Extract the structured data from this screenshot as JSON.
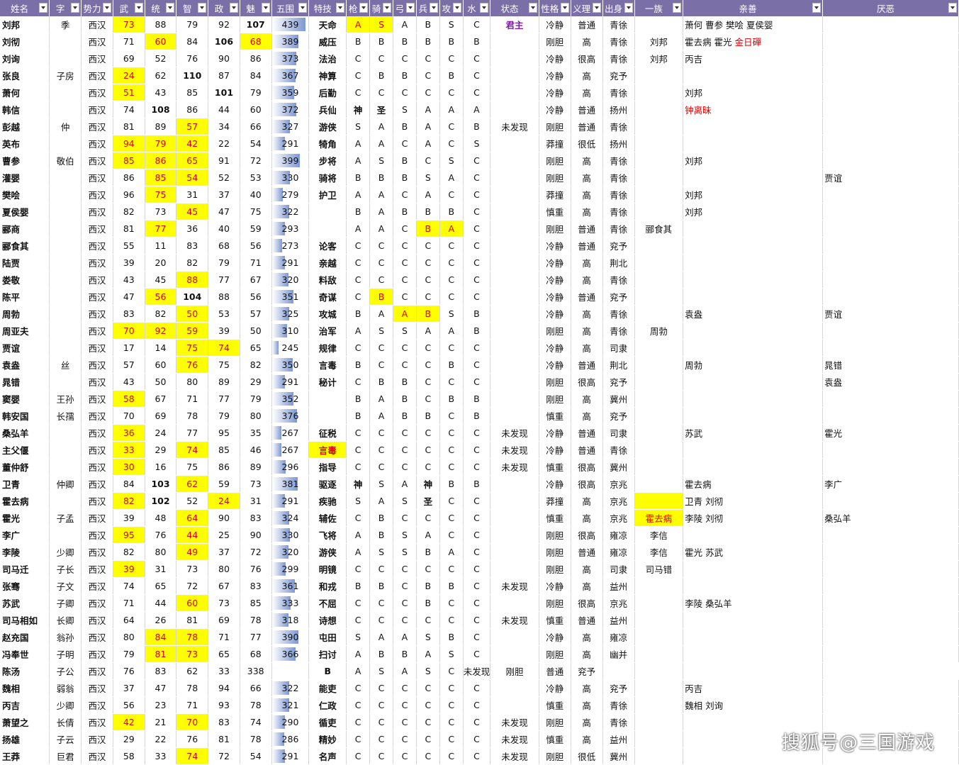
{
  "headers": [
    "姓名",
    "字",
    "势力",
    "武",
    "统",
    "智",
    "政",
    "魅",
    "五围",
    "特技",
    "枪",
    "骑",
    "弓",
    "兵",
    "攻",
    "水",
    "状态",
    "性格",
    "义理",
    "出身",
    "一族",
    "亲善",
    "厌恶"
  ],
  "rows": [
    [
      "刘邦",
      "季",
      "西汉",
      "73",
      "88",
      "79",
      "92",
      "107",
      "439",
      "天命",
      "A",
      "S",
      "A",
      "B",
      "S",
      "C",
      "君主",
      "冷静",
      "普通",
      "青徐",
      "",
      "萧何 曹参 樊哙 夏侯婴",
      ""
    ],
    [
      "刘彻",
      "",
      "西汉",
      "71",
      "60",
      "84",
      "106",
      "68",
      "389",
      "威压",
      "B",
      "B",
      "B",
      "B",
      "B",
      "B",
      "",
      "刚胆",
      "高",
      "青徐",
      "刘邦",
      "霍去病 霍光 金日磾",
      ""
    ],
    [
      "刘询",
      "",
      "西汉",
      "69",
      "52",
      "76",
      "90",
      "86",
      "373",
      "法治",
      "C",
      "C",
      "C",
      "C",
      "C",
      "C",
      "",
      "冷静",
      "很高",
      "青徐",
      "刘邦",
      "丙吉",
      ""
    ],
    [
      "张良",
      "子房",
      "西汉",
      "24",
      "62",
      "110",
      "87",
      "84",
      "367",
      "神算",
      "C",
      "B",
      "B",
      "C",
      "B",
      "C",
      "",
      "冷静",
      "高",
      "兖予",
      "",
      "",
      ""
    ],
    [
      "萧何",
      "",
      "西汉",
      "51",
      "43",
      "85",
      "101",
      "79",
      "359",
      "后勤",
      "C",
      "C",
      "C",
      "C",
      "C",
      "C",
      "",
      "冷静",
      "高",
      "青徐",
      "",
      "刘邦",
      ""
    ],
    [
      "韩信",
      "",
      "西汉",
      "74",
      "108",
      "86",
      "44",
      "60",
      "372",
      "兵仙",
      "神",
      "圣",
      "S",
      "A",
      "A",
      "A",
      "",
      "冷静",
      "普通",
      "扬州",
      "",
      "钟离昧",
      ""
    ],
    [
      "彭越",
      "仲",
      "西汉",
      "81",
      "89",
      "57",
      "34",
      "66",
      "327",
      "游侠",
      "S",
      "A",
      "B",
      "A",
      "C",
      "B",
      "未发现",
      "刚胆",
      "普通",
      "青徐",
      "",
      "",
      ""
    ],
    [
      "英布",
      "",
      "西汉",
      "94",
      "79",
      "42",
      "22",
      "54",
      "291",
      "犄角",
      "A",
      "A",
      "C",
      "A",
      "C",
      "S",
      "",
      "莽撞",
      "很低",
      "扬州",
      "",
      "",
      ""
    ],
    [
      "曹参",
      "敬伯",
      "西汉",
      "85",
      "86",
      "65",
      "91",
      "72",
      "399",
      "步将",
      "A",
      "S",
      "B",
      "C",
      "S",
      "C",
      "",
      "刚胆",
      "高",
      "青徐",
      "",
      "刘邦",
      ""
    ],
    [
      "灌婴",
      "",
      "西汉",
      "86",
      "85",
      "54",
      "52",
      "53",
      "330",
      "骑将",
      "B",
      "B",
      "B",
      "S",
      "A",
      "C",
      "",
      "刚胆",
      "高",
      "青徐",
      "",
      "",
      "贾谊"
    ],
    [
      "樊哙",
      "",
      "西汉",
      "96",
      "75",
      "31",
      "37",
      "40",
      "279",
      "护卫",
      "A",
      "A",
      "C",
      "A",
      "C",
      "C",
      "",
      "莽撞",
      "高",
      "青徐",
      "",
      "刘邦",
      ""
    ],
    [
      "夏侯婴",
      "",
      "西汉",
      "82",
      "73",
      "45",
      "47",
      "75",
      "322",
      "",
      "B",
      "A",
      "B",
      "B",
      "B",
      "C",
      "",
      "慎重",
      "高",
      "青徐",
      "",
      "刘邦",
      ""
    ],
    [
      "郦商",
      "",
      "西汉",
      "81",
      "77",
      "36",
      "40",
      "59",
      "293",
      "",
      "A",
      "A",
      "C",
      "B",
      "A",
      "C",
      "",
      "刚胆",
      "普通",
      "青徐",
      "郦食其",
      "",
      ""
    ],
    [
      "郦食其",
      "",
      "西汉",
      "55",
      "11",
      "83",
      "68",
      "56",
      "273",
      "论客",
      "C",
      "C",
      "C",
      "C",
      "C",
      "C",
      "",
      "冷静",
      "普通",
      "兖予",
      "",
      "",
      ""
    ],
    [
      "陆贾",
      "",
      "西汉",
      "39",
      "20",
      "82",
      "79",
      "71",
      "291",
      "亲越",
      "C",
      "C",
      "C",
      "C",
      "C",
      "C",
      "",
      "冷静",
      "高",
      "荆北",
      "",
      "",
      ""
    ],
    [
      "娄敬",
      "",
      "西汉",
      "43",
      "45",
      "88",
      "77",
      "67",
      "320",
      "料敌",
      "C",
      "C",
      "C",
      "C",
      "C",
      "C",
      "",
      "冷静",
      "高",
      "青徐",
      "",
      "",
      ""
    ],
    [
      "陈平",
      "",
      "西汉",
      "47",
      "56",
      "104",
      "88",
      "56",
      "351",
      "奇谋",
      "C",
      "B",
      "C",
      "C",
      "C",
      "C",
      "",
      "冷静",
      "普通",
      "兖予",
      "",
      "",
      ""
    ],
    [
      "周勃",
      "",
      "西汉",
      "83",
      "82",
      "50",
      "53",
      "57",
      "325",
      "攻城",
      "B",
      "A",
      "A",
      "B",
      "S",
      "B",
      "",
      "冷静",
      "高",
      "青徐",
      "",
      "袁盎",
      "贾谊"
    ],
    [
      "周亚夫",
      "",
      "西汉",
      "70",
      "92",
      "59",
      "39",
      "50",
      "310",
      "治军",
      "A",
      "S",
      "S",
      "A",
      "A",
      "B",
      "",
      "刚胆",
      "高",
      "青徐",
      "周勃",
      "",
      ""
    ],
    [
      "贾谊",
      "",
      "西汉",
      "17",
      "14",
      "75",
      "74",
      "65",
      "245",
      "规律",
      "C",
      "C",
      "C",
      "C",
      "C",
      "C",
      "",
      "冷静",
      "高",
      "司隶",
      "",
      "",
      ""
    ],
    [
      "袁盎",
      "丝",
      "西汉",
      "57",
      "60",
      "76",
      "75",
      "82",
      "350",
      "言毒",
      "B",
      "C",
      "C",
      "C",
      "B",
      "C",
      "",
      "冷静",
      "普通",
      "荆北",
      "",
      "周勃",
      "晁错"
    ],
    [
      "晁错",
      "",
      "西汉",
      "43",
      "50",
      "80",
      "89",
      "29",
      "291",
      "秘计",
      "C",
      "B",
      "B",
      "C",
      "C",
      "C",
      "",
      "刚胆",
      "很高",
      "兖予",
      "",
      "",
      "袁盎"
    ],
    [
      "窦婴",
      "王孙",
      "西汉",
      "58",
      "67",
      "71",
      "77",
      "79",
      "352",
      "",
      "B",
      "A",
      "B",
      "C",
      "B",
      "B",
      "",
      "刚胆",
      "高",
      "冀州",
      "",
      "",
      ""
    ],
    [
      "韩安国",
      "长孺",
      "西汉",
      "70",
      "69",
      "78",
      "79",
      "80",
      "376",
      "",
      "B",
      "A",
      "B",
      "B",
      "C",
      "B",
      "",
      "慎重",
      "高",
      "兖予",
      "",
      "",
      ""
    ],
    [
      "桑弘羊",
      "",
      "西汉",
      "36",
      "24",
      "77",
      "95",
      "35",
      "267",
      "征税",
      "C",
      "C",
      "C",
      "C",
      "C",
      "C",
      "未发现",
      "冷静",
      "普通",
      "司隶",
      "",
      "苏武",
      "霍光"
    ],
    [
      "主父偃",
      "",
      "西汉",
      "33",
      "29",
      "74",
      "85",
      "46",
      "267",
      "言毒",
      "C",
      "C",
      "C",
      "C",
      "C",
      "C",
      "未发现",
      "冷静",
      "普通",
      "青徐",
      "",
      "",
      ""
    ],
    [
      "董仲舒",
      "",
      "西汉",
      "30",
      "16",
      "75",
      "86",
      "89",
      "296",
      "指导",
      "C",
      "C",
      "C",
      "C",
      "C",
      "C",
      "未发现",
      "慎重",
      "很高",
      "冀州",
      "",
      "",
      ""
    ],
    [
      "卫青",
      "仲卿",
      "西汉",
      "84",
      "103",
      "62",
      "59",
      "73",
      "381",
      "驱逐",
      "神",
      "S",
      "A",
      "神",
      "B",
      "B",
      "",
      "冷静",
      "很高",
      "京兆",
      "",
      "霍去病",
      "李广"
    ],
    [
      "霍去病",
      "",
      "西汉",
      "82",
      "102",
      "52",
      "24",
      "31",
      "291",
      "疾驰",
      "S",
      "A",
      "S",
      "圣",
      "C",
      "C",
      "",
      "莽撞",
      "高",
      "京兆",
      "",
      "卫青 刘彻",
      ""
    ],
    [
      "霍光",
      "子孟",
      "西汉",
      "39",
      "48",
      "64",
      "90",
      "83",
      "324",
      "辅佐",
      "C",
      "B",
      "C",
      "C",
      "C",
      "C",
      "",
      "慎重",
      "高",
      "京兆",
      "霍去病",
      "李陵 刘彻",
      "桑弘羊"
    ],
    [
      "李广",
      "",
      "西汉",
      "95",
      "76",
      "44",
      "25",
      "90",
      "330",
      "飞将",
      "A",
      "B",
      "S",
      "A",
      "C",
      "C",
      "",
      "刚胆",
      "很高",
      "雍凉",
      "李信",
      "",
      ""
    ],
    [
      "李陵",
      "少卿",
      "西汉",
      "82",
      "80",
      "49",
      "37",
      "72",
      "320",
      "游侠",
      "A",
      "S",
      "S",
      "B",
      "A",
      "C",
      "",
      "刚胆",
      "普通",
      "雍凉",
      "李信",
      "霍光 苏武",
      ""
    ],
    [
      "司马迁",
      "子长",
      "西汉",
      "39",
      "31",
      "73",
      "80",
      "76",
      "299",
      "明镜",
      "C",
      "C",
      "C",
      "C",
      "C",
      "C",
      "",
      "刚胆",
      "高",
      "司隶",
      "司马错",
      "",
      ""
    ],
    [
      "张骞",
      "子文",
      "西汉",
      "74",
      "65",
      "72",
      "67",
      "83",
      "361",
      "和戎",
      "B",
      "B",
      "C",
      "B",
      "B",
      "C",
      "未发现",
      "冷静",
      "高",
      "益州",
      "",
      "",
      ""
    ],
    [
      "苏武",
      "子卿",
      "西汉",
      "71",
      "44",
      "60",
      "73",
      "85",
      "333",
      "不屈",
      "C",
      "C",
      "C",
      "B",
      "C",
      "C",
      "",
      "刚胆",
      "很高",
      "京兆",
      "",
      "李陵 桑弘羊",
      ""
    ],
    [
      "司马相如",
      "长卿",
      "西汉",
      "64",
      "26",
      "81",
      "69",
      "78",
      "318",
      "诗想",
      "C",
      "C",
      "C",
      "C",
      "C",
      "C",
      "未发现",
      "慎重",
      "普通",
      "益州",
      "",
      "",
      ""
    ],
    [
      "赵充国",
      "翁孙",
      "西汉",
      "80",
      "84",
      "78",
      "71",
      "77",
      "390",
      "屯田",
      "S",
      "A",
      "A",
      "S",
      "B",
      "C",
      "",
      "冷静",
      "高",
      "雍凉",
      "",
      "",
      ""
    ],
    [
      "冯奉世",
      "子明",
      "西汉",
      "79",
      "81",
      "73",
      "65",
      "68",
      "366",
      "扫讨",
      "A",
      "B",
      "B",
      "A",
      "S",
      "C",
      "",
      "刚胆",
      "高",
      "幽并",
      "",
      "",
      ""
    ],
    [
      "陈汤",
      "子公",
      "西汉",
      "76",
      "83",
      "62",
      "33",
      "338",
      "",
      "B",
      "A",
      "S",
      "A",
      "S",
      "C",
      "未发现",
      "刚胆",
      "普通",
      "兖予",
      "",
      "",
      ""
    ],
    [
      "魏相",
      "弱翁",
      "西汉",
      "37",
      "47",
      "78",
      "94",
      "66",
      "322",
      "能吏",
      "C",
      "C",
      "C",
      "C",
      "C",
      "C",
      "",
      "冷静",
      "高",
      "兖予",
      "",
      "丙吉",
      ""
    ],
    [
      "丙吉",
      "少卿",
      "西汉",
      "56",
      "23",
      "71",
      "93",
      "78",
      "321",
      "仁政",
      "C",
      "C",
      "C",
      "C",
      "C",
      "C",
      "",
      "慎重",
      "高",
      "青徐",
      "",
      "魏相 刘询",
      ""
    ],
    [
      "萧望之",
      "长倩",
      "西汉",
      "42",
      "21",
      "70",
      "83",
      "74",
      "290",
      "循吏",
      "C",
      "C",
      "C",
      "C",
      "C",
      "C",
      "未发现",
      "刚胆",
      "高",
      "青徐",
      "",
      "",
      ""
    ],
    [
      "扬雄",
      "子云",
      "西汉",
      "29",
      "22",
      "76",
      "81",
      "78",
      "286",
      "精妙",
      "C",
      "C",
      "C",
      "C",
      "C",
      "C",
      "未发现",
      "慎重",
      "高",
      "益州",
      "",
      "",
      ""
    ],
    [
      "王莽",
      "巨君",
      "西汉",
      "58",
      "33",
      "74",
      "72",
      "54",
      "291",
      "名声",
      "C",
      "C",
      "C",
      "C",
      "C",
      "C",
      "未发现",
      "刚胆",
      "很低",
      "冀州",
      "",
      "",
      ""
    ]
  ],
  "highlights": {
    "刘邦": {
      "3": "hl",
      "10": "hl",
      "11": "hl",
      "16": "purple",
      "7": "b"
    },
    "刘彻": {
      "4": "hl",
      "7": "hl",
      "6": "b"
    },
    "张良": {
      "3": "hl",
      "5": "b"
    },
    "萧何": {
      "3": "hl",
      "6": "b"
    },
    "韩信": {
      "4": "b"
    },
    "彭越": {
      "5": "hl"
    },
    "英布": {
      "3": "hl",
      "4": "hl",
      "5": "hl"
    },
    "曹参": {
      "3": "hl",
      "4": "hl",
      "5": "hl"
    },
    "灌婴": {
      "4": "hl",
      "5": "hl"
    },
    "樊哙": {
      "4": "hl"
    },
    "夏侯婴": {
      "5": "hl"
    },
    "郦商": {
      "4": "hl",
      "13": "hl",
      "14": "hl"
    },
    "娄敬": {
      "5": "hl"
    },
    "陈平": {
      "4": "hl",
      "5": "b",
      "11": "hl"
    },
    "周勃": {
      "5": "hl",
      "12": "hl",
      "13": "hl"
    },
    "周亚夫": {
      "3": "hl",
      "4": "hl",
      "5": "hl"
    },
    "贾谊": {
      "5": "hl",
      "6": "hl"
    },
    "袁盎": {
      "5": "hl"
    },
    "窦婴": {
      "3": "hl"
    },
    "桑弘羊": {
      "3": "hl"
    },
    "主父偃": {
      "3": "hl",
      "5": "hl",
      "9": "hl"
    },
    "董仲舒": {
      "3": "hl"
    },
    "卫青": {
      "4": "b",
      "5": "hl"
    },
    "霍去病": {
      "3": "hl",
      "4": "b",
      "6": "hl",
      "20": "hl"
    },
    "霍光": {
      "5": "hl",
      "20": "hl"
    },
    "李广": {
      "3": "hl",
      "5": "hl"
    },
    "李陵": {
      "5": "hl"
    },
    "司马迁": {
      "3": "hl"
    },
    "苏武": {
      "5": "hl"
    },
    "赵充国": {
      "4": "hl",
      "5": "hl"
    },
    "冯奉世": {
      "4": "hl",
      "5": "hl"
    },
    "萧望之": {
      "3": "hl",
      "5": "hl"
    },
    "王莽": {
      "5": "hl"
    }
  },
  "red_text_suffix": {
    "刘彻": "金日磾",
    "韩信": "钟离昧"
  },
  "watermark": "搜狐号@三国游戏"
}
